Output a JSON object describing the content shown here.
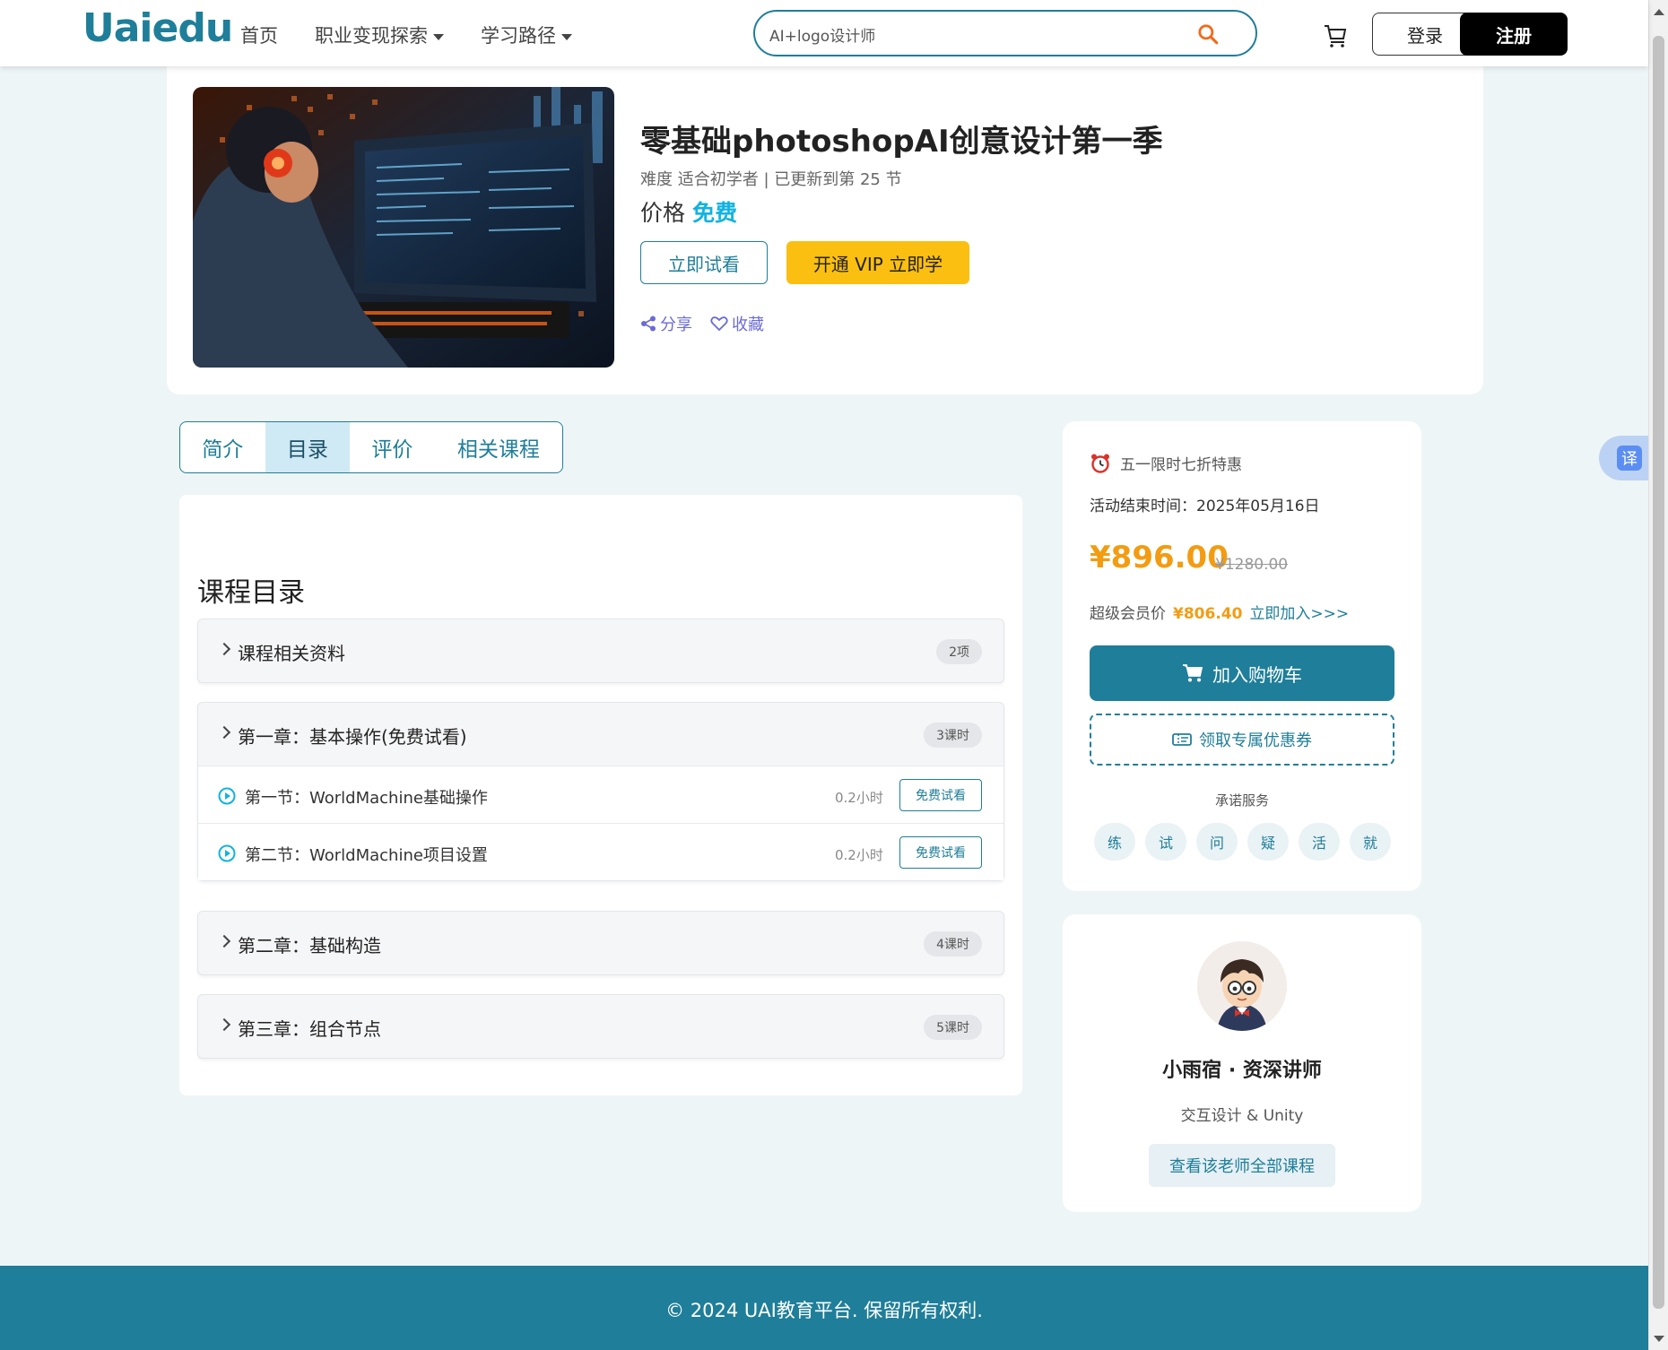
{
  "header": {
    "logo": "Uaiedu",
    "nav": {
      "home": "首页",
      "career": "职业变现探索",
      "path": "学习路径"
    },
    "search": {
      "value": "AI+logo设计师"
    },
    "login": "登录",
    "register": "注册"
  },
  "course": {
    "title": "零基础photoshopAI创意设计第一季",
    "meta": "难度 适合初学者 | 已更新到第 25 节",
    "price_label": "价格",
    "price_value": "免费",
    "trial_button": "立即试看",
    "vip_button": "开通 VIP 立即学",
    "share": "分享",
    "favorite": "收藏"
  },
  "tabs": [
    {
      "label": "简介",
      "active": false
    },
    {
      "label": "目录",
      "active": true
    },
    {
      "label": "评价",
      "active": false
    },
    {
      "label": "相关课程",
      "active": false
    }
  ],
  "catalog": {
    "title": "课程目录",
    "chapters": [
      {
        "title": "课程相关资料",
        "count": "2项",
        "lessons": []
      },
      {
        "title": "第一章：基本操作(免费试看)",
        "count": "3课时",
        "lessons": [
          {
            "title": "第一节：WorldMachine基础操作",
            "duration": "0.2小时",
            "action": "免费试看"
          },
          {
            "title": "第二节：WorldMachine项目设置",
            "duration": "0.2小时",
            "action": "免费试看"
          }
        ]
      },
      {
        "title": "第二章：基础构造",
        "count": "4课时",
        "lessons": []
      },
      {
        "title": "第三章：组合节点",
        "count": "5课时",
        "lessons": []
      }
    ]
  },
  "promo": {
    "headline": "五一限时七折特惠",
    "end_time": "活动结束时间：2025年05月16日",
    "price": "¥896.00",
    "original_price": "¥1280.00",
    "vip_label": "超级会员价",
    "vip_price": "¥806.40",
    "vip_join": "立即加入>>>",
    "cart_button": "加入购物车",
    "coupon_button": "领取专属优惠券",
    "service_label": "承诺服务",
    "services": [
      "练",
      "试",
      "问",
      "疑",
      "活",
      "就"
    ]
  },
  "teacher": {
    "name": "小雨宿 · 资深讲师",
    "field": "交互设计 & Unity",
    "all_courses_button": "查看该老师全部课程"
  },
  "translate": {
    "label": "译"
  },
  "footer": {
    "text": "© 2024 UAI教育平台. 保留所有权利."
  },
  "colors": {
    "brand": "#1f7e99",
    "accent_yellow": "#fbbf11",
    "price_orange": "#f39c12",
    "free_blue": "#10b3e0"
  }
}
